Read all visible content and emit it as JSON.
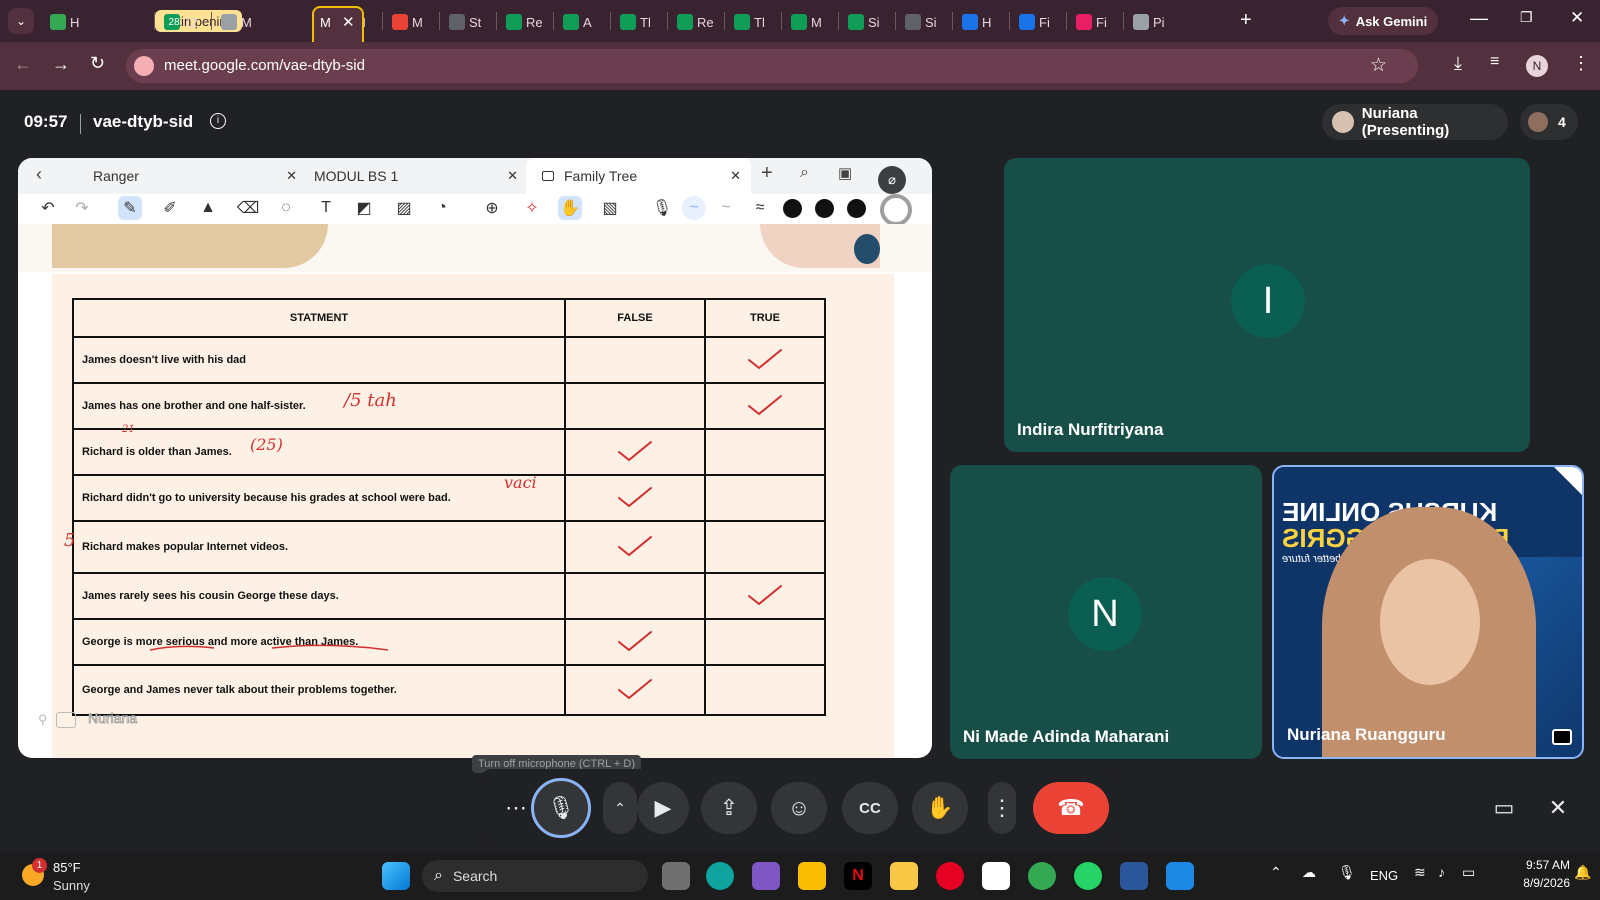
{
  "browser": {
    "tabs": [
      {
        "label": "H",
        "color": "#34a853"
      },
      {
        "label": "Bikin pening",
        "color": "#fde293",
        "group": true
      },
      {
        "label": "(2",
        "badge": "28",
        "color": "#0f9d58"
      },
      {
        "label": "M",
        "color": "#9aa0a6"
      },
      {
        "label": "M",
        "color": "#00897b",
        "active": true
      },
      {
        "label": "M",
        "color": "#34a853"
      },
      {
        "label": "M",
        "color": "#ea4335"
      },
      {
        "label": "St",
        "color": "#5f6368"
      },
      {
        "label": "Re",
        "color": "#0f9d58"
      },
      {
        "label": "A",
        "color": "#0f9d58"
      },
      {
        "label": "Tl",
        "color": "#0f9d58"
      },
      {
        "label": "Re",
        "color": "#0f9d58"
      },
      {
        "label": "Tl",
        "color": "#0f9d58"
      },
      {
        "label": "M",
        "color": "#0f9d58"
      },
      {
        "label": "Si",
        "color": "#0f9d58"
      },
      {
        "label": "Si",
        "color": "#5f6368"
      },
      {
        "label": "H",
        "color": "#1a73e8"
      },
      {
        "label": "Fi",
        "color": "#1a73e8"
      },
      {
        "label": "Fi",
        "color": "#e91e63"
      },
      {
        "label": "Pi",
        "color": "#9aa0a6"
      }
    ],
    "new_tab": "+",
    "gemini_label": "Ask Gemini",
    "url": "meet.google.com/vae-dtyb-sid",
    "profile_initial": "N"
  },
  "meeting": {
    "time": "09:57",
    "code": "vae-dtyb-sid",
    "presenter": "Nuriana (Presenting)",
    "participant_count": "4"
  },
  "board": {
    "tabs": [
      "Ranger",
      "MODUL BS 1",
      "Family Tree"
    ],
    "footer_name": "Nuriana",
    "table": {
      "headers": [
        "STATMENT",
        "FALSE",
        "TRUE"
      ],
      "rows": [
        {
          "statement": "James doesn't live with his dad",
          "answer": "TRUE"
        },
        {
          "statement": "James has one brother and one half-sister.",
          "answer": "TRUE"
        },
        {
          "statement": "Richard is older than James.",
          "answer": "FALSE"
        },
        {
          "statement": "Richard didn't go to university because his grades at school were bad.",
          "answer": "FALSE"
        },
        {
          "statement": "Richard makes popular Internet videos.",
          "answer": "FALSE"
        },
        {
          "statement": "James rarely sees his cousin George these days.",
          "answer": "TRUE"
        },
        {
          "statement": "George is more serious and more active than James.",
          "answer": "FALSE"
        },
        {
          "statement": "George and James never talk about their problems together.",
          "answer": "FALSE"
        }
      ]
    },
    "handwriting": {
      "row2": "/5 tah",
      "row3": "(25)",
      "row3_sup": "21",
      "row4": "vaci",
      "margin_mark": "5"
    }
  },
  "participants": [
    {
      "name": "Indira Nurfitriyana",
      "initial": "I"
    },
    {
      "name": "Ni Made Adinda Maharani",
      "initial": "N"
    },
    {
      "name": "Nuriana Ruangguru",
      "video": true,
      "backdrop_text": [
        "KURSUS ONLINE",
        "BAHASA INGGRIS",
        "Speaking for a better future"
      ]
    }
  ],
  "tooltip": "Turn off microphone (CTRL + D)",
  "taskbar": {
    "weather_temp": "85°F",
    "weather_desc": "Sunny",
    "weather_badge": "1",
    "search_label": "Search",
    "lang": "ENG",
    "clock_time": "9:57 AM",
    "clock_date": "8/9/2026"
  },
  "colors": {
    "accent": "#8ab4f8",
    "end_call": "#ea4335",
    "tile": "#174e47",
    "tab_group": "#fde293"
  }
}
